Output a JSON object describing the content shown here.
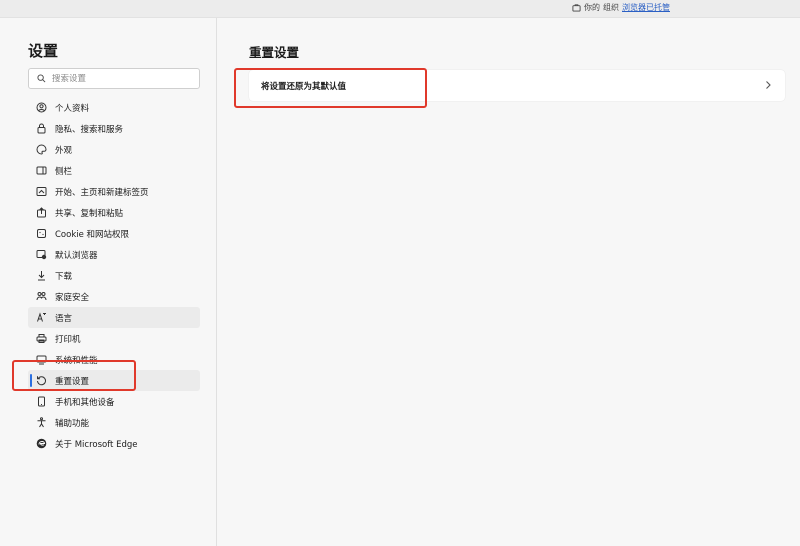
{
  "topbar": {
    "managed_prefix": "你的",
    "managed_mid": "组织",
    "managed_link": "浏览器已托管"
  },
  "sidebar": {
    "title": "设置",
    "search_placeholder": "搜索设置",
    "items": [
      {
        "label": "个人资料",
        "icon": "profile-icon"
      },
      {
        "label": "隐私、搜索和服务",
        "icon": "lock-icon"
      },
      {
        "label": "外观",
        "icon": "palette-icon"
      },
      {
        "label": "侧栏",
        "icon": "sidebar-icon"
      },
      {
        "label": "开始、主页和新建标签页",
        "icon": "home-tab-icon"
      },
      {
        "label": "共享、复制和粘贴",
        "icon": "share-icon"
      },
      {
        "label": "Cookie 和网站权限",
        "icon": "cookie-icon"
      },
      {
        "label": "默认浏览器",
        "icon": "browser-icon"
      },
      {
        "label": "下载",
        "icon": "download-icon"
      },
      {
        "label": "家庭安全",
        "icon": "family-icon"
      },
      {
        "label": "语言",
        "icon": "language-icon"
      },
      {
        "label": "打印机",
        "icon": "printer-icon"
      },
      {
        "label": "系统和性能",
        "icon": "system-icon"
      },
      {
        "label": "重置设置",
        "icon": "reset-icon"
      },
      {
        "label": "手机和其他设备",
        "icon": "phone-icon"
      },
      {
        "label": "辅助功能",
        "icon": "accessibility-icon"
      },
      {
        "label": "关于 Microsoft Edge",
        "icon": "edge-logo-icon"
      }
    ],
    "active_index": 13,
    "hover_index": 10
  },
  "main": {
    "title": "重置设置",
    "card_label": "将设置还原为其默认值"
  },
  "colors": {
    "accent": "#2b6fe0",
    "highlight_box": "#e0392b",
    "sidebar_bg": "#f7f7f7"
  }
}
